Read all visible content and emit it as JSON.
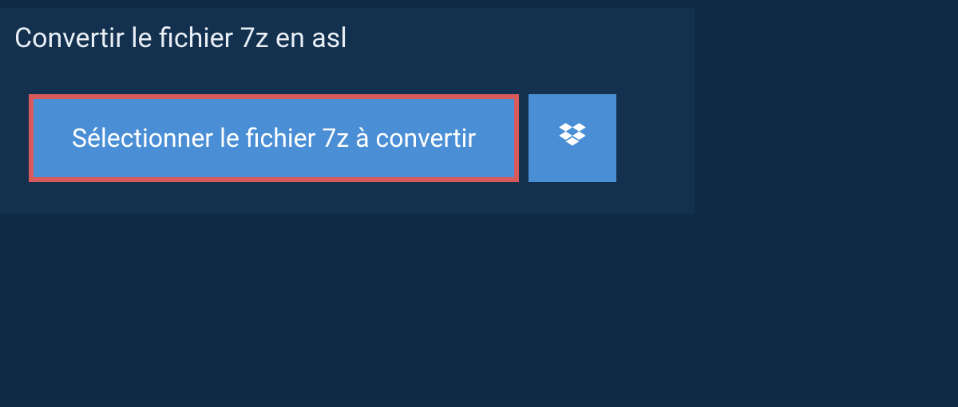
{
  "title": "Convertir le fichier 7z en asl",
  "buttons": {
    "select_file": "Sélectionner le fichier 7z à convertir"
  },
  "colors": {
    "background": "#0f2a44",
    "panel": "#13314f",
    "button_primary": "#4a8fd6",
    "highlight_border": "#d95a5a",
    "text_light": "#e8eef4"
  }
}
